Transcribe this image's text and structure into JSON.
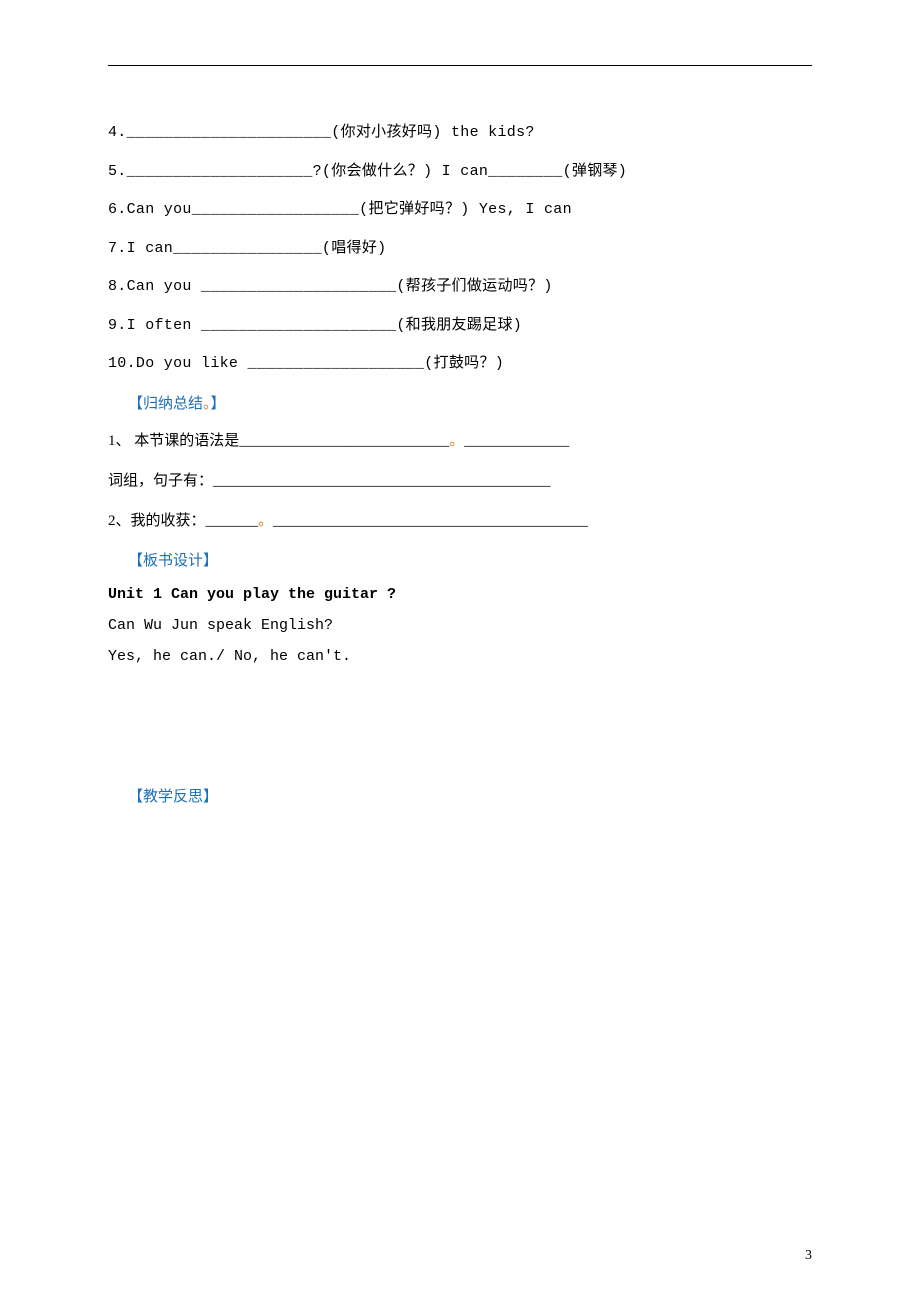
{
  "exercises": {
    "q4": {
      "prefix": "4.______________________(",
      "hint": "你对小孩好吗",
      "suffix": ") the kids?"
    },
    "q5": {
      "prefix": "5.____________________?(",
      "hint1": "你会做什么？",
      "mid": ") I can________(",
      "hint2": "弹钢琴",
      "suffix": ")"
    },
    "q6": {
      "prefix": "6.Can you__________________(",
      "hint": "把它弹好吗？",
      "suffix": ") Yes, I can"
    },
    "q7": {
      "prefix": "7.I can________________(",
      "hint": "唱得好",
      "suffix": ")"
    },
    "q8": {
      "prefix": "8.Can you _____________________(",
      "hint": "帮孩子们做运动吗？",
      "suffix": ")"
    },
    "q9": {
      "prefix": "9.I often _____________________(",
      "hint": "和我朋友踢足球",
      "suffix": ")"
    },
    "q10": {
      "prefix": "10.Do you like ___________________(",
      "hint": "打鼓吗？",
      "suffix": ")"
    }
  },
  "headings": {
    "summary": "【归纳总结",
    "summary_dot": "。",
    "summary_close": "】",
    "board": "【板书设计】",
    "reflection": "【教学反思】"
  },
  "summary": {
    "line1_prefix": "1、 本节课的语法是____________________________",
    "line1_dot": "。",
    "line1_suffix": "______________",
    "line2": "词组，句子有：_____________________________________________",
    "line3_prefix": "2、我的收获：_______",
    "line3_dot": "。",
    "line3_suffix": "__________________________________________"
  },
  "board_design": {
    "unit_title": "Unit 1 Can you play the guitar ?",
    "example_q": "Can Wu Jun speak English?",
    "example_a": "Yes, he can./ No, he can't."
  },
  "page_number": "3"
}
